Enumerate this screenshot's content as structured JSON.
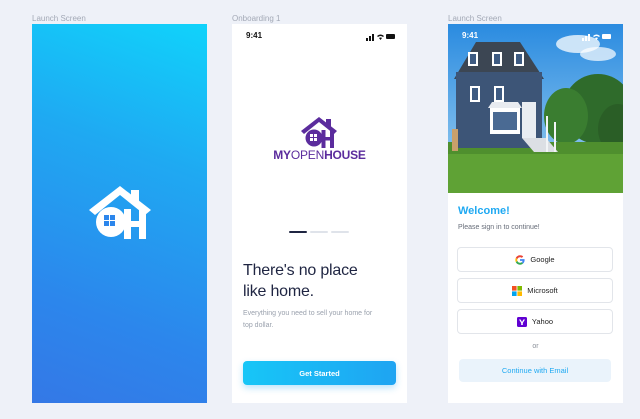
{
  "frames": {
    "launch_label": "Launch Screen",
    "onboarding_label": "Onboarding 1",
    "signin_label": "Launch Screen"
  },
  "status_bar": {
    "time": "9:41"
  },
  "onboarding": {
    "brand": {
      "part1": "MY",
      "part2": "OPEN",
      "part3": "HOUSE"
    },
    "headline_line1": "There's no place",
    "headline_line2": "like home.",
    "subtext": "Everything you need to sell your home for top dollar.",
    "cta_label": "Get Started",
    "pager": {
      "pages": 3,
      "active": 0
    }
  },
  "signin": {
    "welcome": "Welcome!",
    "prompt": "Please sign in to continue!",
    "providers": [
      {
        "label": "Google",
        "icon": "google-icon"
      },
      {
        "label": "Microsoft",
        "icon": "microsoft-icon"
      },
      {
        "label": "Yahoo",
        "icon": "yahoo-icon"
      }
    ],
    "separator": "or",
    "email_button": "Continue with Email"
  },
  "colors": {
    "brand_purple": "#5b2c9d",
    "accent_blue": "#1fa9f2",
    "cyan": "#17c6f7",
    "page_bg": "#eef1f8"
  }
}
